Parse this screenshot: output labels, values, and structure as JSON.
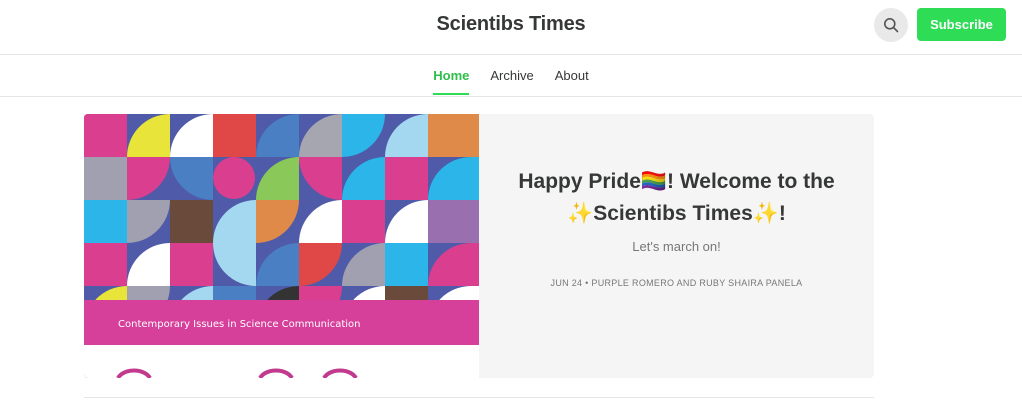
{
  "header": {
    "site_title": "Scientibs Times",
    "subscribe_label": "Subscribe",
    "search_icon": "search-icon"
  },
  "nav": {
    "items": [
      {
        "label": "Home",
        "active": true
      },
      {
        "label": "Archive",
        "active": false
      },
      {
        "label": "About",
        "active": false
      }
    ]
  },
  "featured_post": {
    "title": "Happy Pride🏳️‍🌈! Welcome to the ✨Scientibs Times✨!",
    "subtitle": "Let's march on!",
    "meta": "JUN 24 • PURPLE ROMERO AND RUBY SHAIRA PANELA",
    "cover_banner_text": "Contemporary Issues in Science Communication"
  },
  "colors": {
    "accent": "#2fdc55",
    "text": "#363737",
    "muted": "#777777",
    "card_bg": "#f5f5f5",
    "cover_banner": "#d63f9a"
  }
}
